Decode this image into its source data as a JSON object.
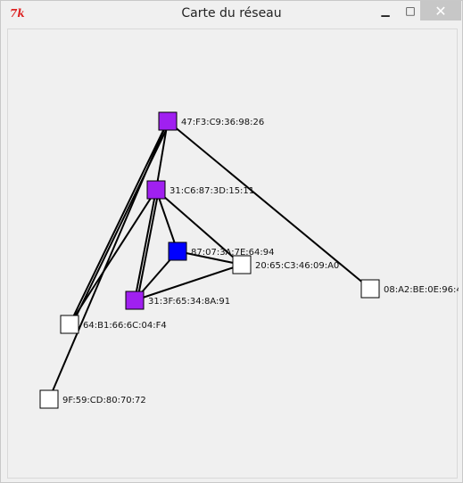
{
  "window": {
    "title": "Carte du réseau",
    "app_icon_text": "7k",
    "minimize_glyph": "▁",
    "maximize_glyph": "□",
    "close_glyph": "✕"
  },
  "colors": {
    "purple": "#a020f0",
    "blue": "#0000ff",
    "white": "#ffffff",
    "edge": "#000000"
  },
  "nodes": [
    {
      "id": "n1",
      "label": "47:F3:C9:36:98:26",
      "color": "purple"
    },
    {
      "id": "n2",
      "label": "31:C6:87:3D:15:11",
      "color": "purple"
    },
    {
      "id": "n3",
      "label": "87:07:3A:7E:64:94",
      "color": "blue"
    },
    {
      "id": "n4",
      "label": "20:65:C3:46:09:A0",
      "color": "white"
    },
    {
      "id": "n5",
      "label": "08:A2:BE:0E:96:4",
      "color": "white"
    },
    {
      "id": "n6",
      "label": "31:3F:65:34:8A:91",
      "color": "purple"
    },
    {
      "id": "n7",
      "label": "64:B1:66:6C:04:F4",
      "color": "white"
    },
    {
      "id": "n8",
      "label": "9F:59:CD:80:70:72",
      "color": "white"
    }
  ],
  "edges": [
    [
      "n1",
      "n2"
    ],
    [
      "n1",
      "n5"
    ],
    [
      "n1",
      "n7"
    ],
    [
      "n1",
      "n7"
    ],
    [
      "n1",
      "n8"
    ],
    [
      "n2",
      "n3"
    ],
    [
      "n2",
      "n4"
    ],
    [
      "n2",
      "n6"
    ],
    [
      "n2",
      "n6"
    ],
    [
      "n2",
      "n7"
    ],
    [
      "n3",
      "n4"
    ],
    [
      "n3",
      "n6"
    ],
    [
      "n6",
      "n4"
    ]
  ]
}
